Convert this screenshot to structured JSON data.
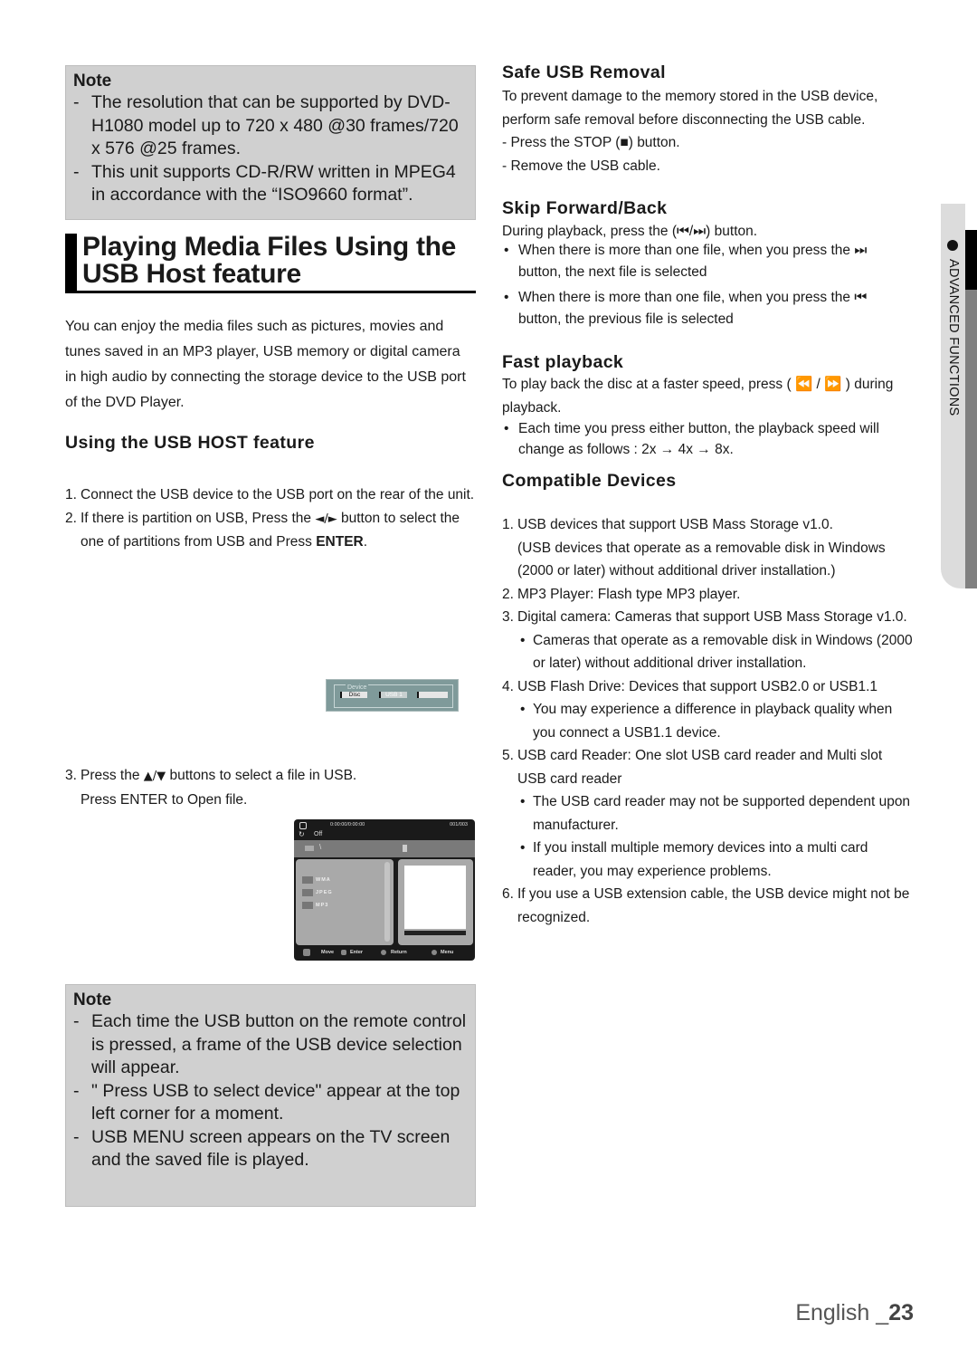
{
  "note_top": {
    "title": "Note",
    "items": [
      "The resolution that can be supported by DVD-H1080 model up to 720 x 480 @30 frames/720 x 576 @25 frames.",
      "This unit supports CD-R/RW written in MPEG4 in accordance with the “ISO9660 format”."
    ]
  },
  "page_title": {
    "line1": "Playing Media Files Using the",
    "line2": "USB Host feature"
  },
  "intro": "You can enjoy the media files such as pictures, movies and tunes saved in an MP3 player, USB memory or digital camera in high audio by connecting the storage device to the USB port of the DVD Player.",
  "using_usb": {
    "heading": "Using the USB HOST feature",
    "steps": [
      {
        "num": "1.",
        "text": "Connect the USB device to the USB port on the rear of the unit."
      },
      {
        "num": "2.",
        "pre": "If there is partition on USB, Press the ",
        "glyph": "◄/►",
        "post": " button to select the one of partitions from USB and Press ",
        "bold": "ENTER",
        "end": "."
      },
      {
        "num": "3.",
        "pre": "Press the ",
        "glyph": "▲/▼",
        "post": " buttons to select a file in USB. Press ENTER to Open file."
      }
    ]
  },
  "device_screen": {
    "legend": "Device",
    "buttons": [
      "Disc",
      "USB 1",
      ""
    ]
  },
  "usb_menu_screen": {
    "time": "0:00:00/0:00:00",
    "count": "001/003",
    "repeat": "Off",
    "path": "\\",
    "folders": [
      "WMA",
      "JPEG",
      "MP3"
    ],
    "hints": [
      "Move",
      "Enter",
      "Return",
      "Menu"
    ]
  },
  "note_bottom": {
    "title": "Note",
    "items": [
      "Each time the USB button on the remote control is pressed, a frame of the USB device selection will appear.",
      "\" Press USB to select device\" appear at the top left corner for a moment.",
      "USB MENU screen appears on the TV screen and the saved file is played."
    ]
  },
  "safe_removal": {
    "heading": "Safe USB Removal",
    "text": "To prevent damage to the memory stored in the USB device, perform safe removal before disconnecting the USB cable.",
    "steps": [
      "- Press the STOP (■) button.",
      "- Remove the USB cable."
    ]
  },
  "skip": {
    "heading": "Skip Forward/Back",
    "text": "During playback, press the (⏮/⏭) button.",
    "bullets": [
      "When there is more than one file, when you press the ⏭ button, the next file is selected",
      "When there is more than one file, when you press the ⏮ button, the previous file is selected"
    ]
  },
  "fast": {
    "heading": "Fast playback",
    "text": "To play back the disc at a faster speed, press  ( ⏪ / ⏩ ) during playback.",
    "bullets": [
      "Each time you press either button, the playback speed will change as follows : 2x → 4x → 8x."
    ]
  },
  "compatible": {
    "heading": "Compatible Devices",
    "items": [
      {
        "num": "1.",
        "text": "USB devices that support USB Mass Storage v1.0.",
        "extra": "(USB devices that operate as a removable disk in Windows (2000 or later) without additional driver installation.)"
      },
      {
        "num": "2.",
        "text": "MP3 Player: Flash type MP3 player."
      },
      {
        "num": "3.",
        "text": "Digital camera: Cameras that support USB Mass Storage v1.0.",
        "subs": [
          "Cameras that operate as a removable disk in Windows (2000 or later) without additional driver installation."
        ]
      },
      {
        "num": "4.",
        "text": "USB Flash Drive: Devices that support USB2.0 or USB1.1",
        "subs": [
          "You may experience a difference in playback quality when you connect a USB1.1 device."
        ]
      },
      {
        "num": "5.",
        "text": "USB card Reader: One slot USB card reader and Multi slot USB card reader",
        "subs": [
          "The USB card reader may not be supported dependent upon manufacturer.",
          "If you install multiple memory devices into a multi card reader, you may experience problems."
        ]
      },
      {
        "num": "6.",
        "text": "If you use a USB extension cable, the USB device might not be recognized."
      }
    ]
  },
  "side_tab": {
    "label": "ADVANCED FUNCTIONS"
  },
  "footer": {
    "lang": "English _",
    "page": "23"
  }
}
